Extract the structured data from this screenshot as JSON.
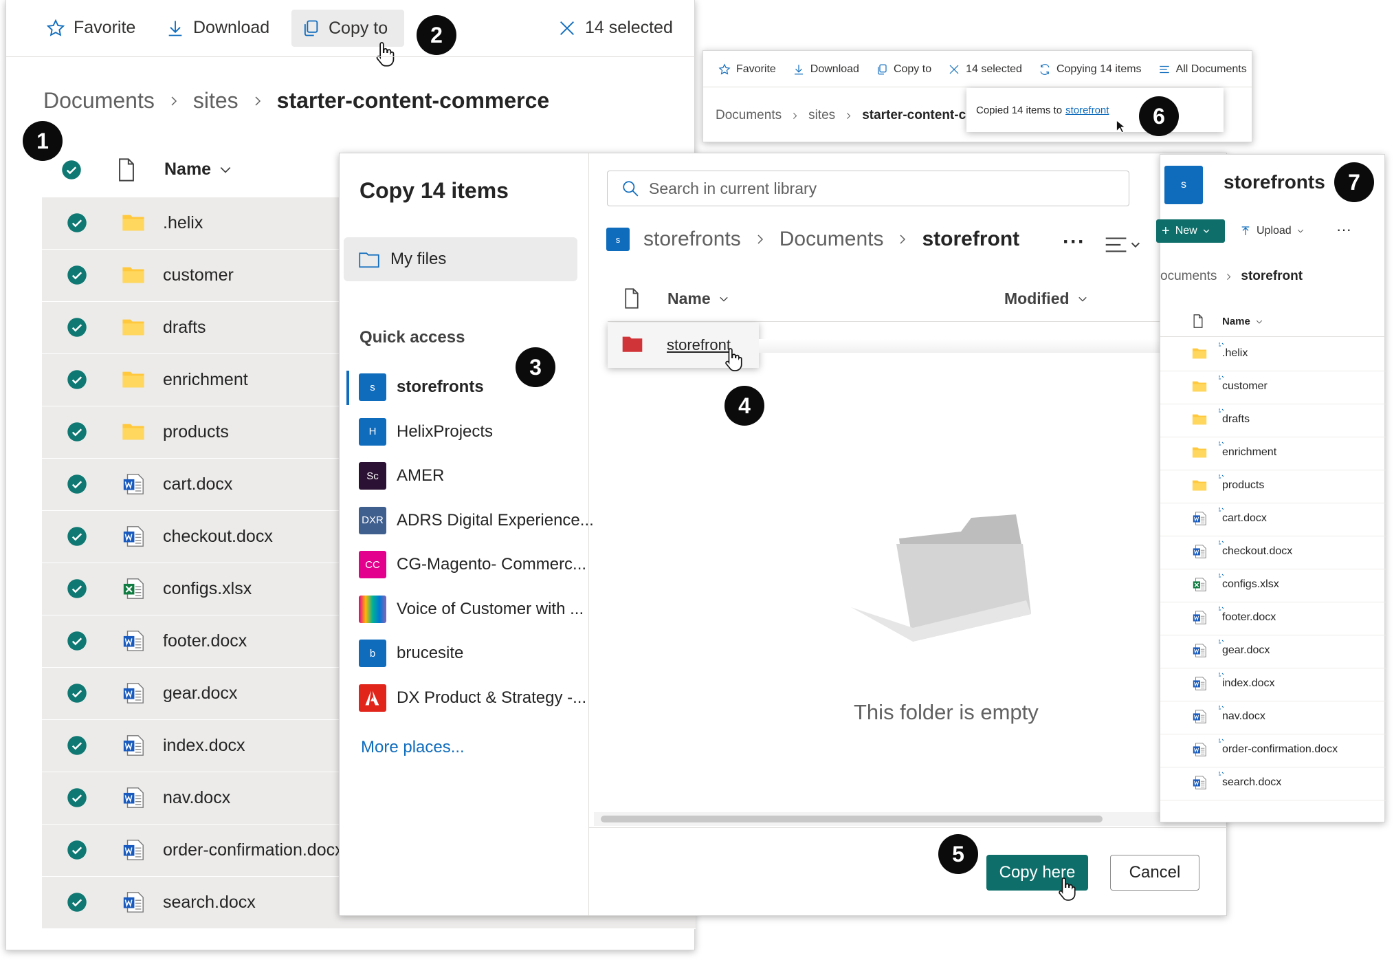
{
  "main": {
    "toolbar": {
      "favorite": "Favorite",
      "download": "Download",
      "copy_to": "Copy to",
      "selected": "14 selected"
    },
    "breadcrumb": [
      "Documents",
      "sites",
      "starter-content-commerce"
    ],
    "header": {
      "name": "Name"
    },
    "rows": [
      {
        "name": ".helix",
        "type": "folder"
      },
      {
        "name": "customer",
        "type": "folder"
      },
      {
        "name": "drafts",
        "type": "folder"
      },
      {
        "name": "enrichment",
        "type": "folder"
      },
      {
        "name": "products",
        "type": "folder"
      },
      {
        "name": "cart.docx",
        "type": "word"
      },
      {
        "name": "checkout.docx",
        "type": "word"
      },
      {
        "name": "configs.xlsx",
        "type": "excel"
      },
      {
        "name": "footer.docx",
        "type": "word"
      },
      {
        "name": "gear.docx",
        "type": "word"
      },
      {
        "name": "index.docx",
        "type": "word"
      },
      {
        "name": "nav.docx",
        "type": "word"
      },
      {
        "name": "order-confirmation.docx",
        "type": "word"
      },
      {
        "name": "search.docx",
        "type": "word"
      }
    ]
  },
  "dialog": {
    "title": "Copy 14 items",
    "my_files": "My files",
    "quick_access": "Quick access",
    "sites": [
      {
        "label": "storefronts",
        "badge": "s",
        "color": "#0f6cbd"
      },
      {
        "label": "HelixProjects",
        "badge": "H",
        "color": "#0f6cbd"
      },
      {
        "label": "AMER",
        "badge": "Sc",
        "color": "#2b1133"
      },
      {
        "label": "ADRS Digital Experience...",
        "badge": "DXR",
        "color": "#3f5f8f"
      },
      {
        "label": "CG-Magento- Commerc...",
        "badge": "CC",
        "color": "#e3008c"
      },
      {
        "label": "Voice of Customer with ...",
        "badge": "",
        "color": "#7a5cff"
      },
      {
        "label": "brucesite",
        "badge": "b",
        "color": "#0f6cbd"
      },
      {
        "label": "DX Product & Strategy -...",
        "badge": "",
        "color": "#e1251b"
      }
    ],
    "more_places": "More places...",
    "search_placeholder": "Search in current library",
    "path": [
      "storefronts",
      "Documents",
      "storefront"
    ],
    "path_badge": "s",
    "col_name": "Name",
    "col_modified": "Modified",
    "folder_item": "storefront",
    "empty_text": "This folder is empty",
    "copy_here": "Copy here",
    "cancel": "Cancel"
  },
  "toast": {
    "toolbar": {
      "favorite": "Favorite",
      "download": "Download",
      "copy_to": "Copy to",
      "selected": "14 selected",
      "copying": "Copying 14 items",
      "all_docs": "All Documents"
    },
    "breadcrumb": [
      "Documents",
      "sites",
      "starter-content-c"
    ],
    "message_prefix": "Copied 14 items to",
    "message_link": "storefront"
  },
  "storefronts_panel": {
    "badge": "s",
    "title": "storefronts",
    "new": "New",
    "upload": "Upload",
    "breadcrumb_prev": "ocuments",
    "breadcrumb_cur": "storefront",
    "col_name": "Name",
    "rows": [
      {
        "name": ".helix",
        "type": "folder"
      },
      {
        "name": "customer",
        "type": "folder"
      },
      {
        "name": "drafts",
        "type": "folder"
      },
      {
        "name": "enrichment",
        "type": "folder"
      },
      {
        "name": "products",
        "type": "folder"
      },
      {
        "name": "cart.docx",
        "type": "word"
      },
      {
        "name": "checkout.docx",
        "type": "word"
      },
      {
        "name": "configs.xlsx",
        "type": "excel"
      },
      {
        "name": "footer.docx",
        "type": "word"
      },
      {
        "name": "gear.docx",
        "type": "word"
      },
      {
        "name": "index.docx",
        "type": "word"
      },
      {
        "name": "nav.docx",
        "type": "word"
      },
      {
        "name": "order-confirmation.docx",
        "type": "word"
      },
      {
        "name": "search.docx",
        "type": "word"
      }
    ]
  },
  "callouts": [
    "1",
    "2",
    "3",
    "4",
    "5",
    "6",
    "7"
  ],
  "colors": {
    "accent": "#0f6cbd",
    "teal": "#0e6f6a",
    "check": "#0f7872",
    "folder": "#ffc83d"
  }
}
